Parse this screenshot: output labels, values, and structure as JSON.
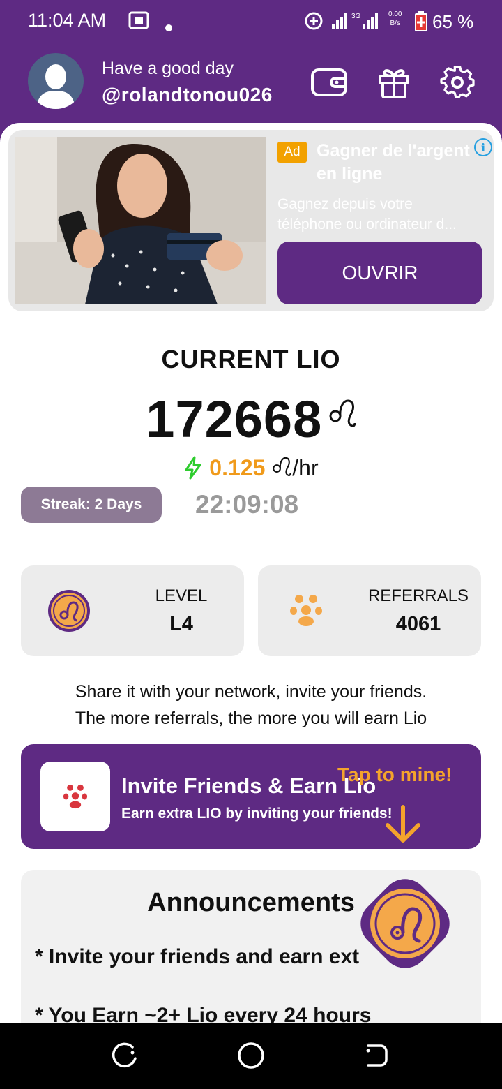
{
  "status_bar": {
    "time": "11:04 AM",
    "net_speed_value": "0.00",
    "net_speed_unit": "B/s",
    "network_type": "3G",
    "battery": "65 %"
  },
  "header": {
    "greeting": "Have a good day",
    "username": "@rolandtonou026",
    "icons": [
      "wallet-icon",
      "gift-icon",
      "settings-icon"
    ]
  },
  "ad": {
    "badge": "Ad",
    "title": "Gagner de l'argent en ligne",
    "description_line1": "Gagnez depuis votre",
    "description_line2": "téléphone ou ordinateur d...",
    "cta": "OUVRIR"
  },
  "mining": {
    "label": "CURRENT LIO",
    "balance": "172668",
    "currency_symbol": "♌",
    "rate_value": "0.125",
    "rate_unit": "/hr",
    "streak": "Streak: 2 Days",
    "timer": "22:09:08"
  },
  "stats": {
    "level_label": "LEVEL",
    "level_value": "L4",
    "referrals_label": "REFERRALS",
    "referrals_value": "4061"
  },
  "share": {
    "line1": "Share it with your network, invite your friends.",
    "line2": "The more referrals, the more you will earn Lio"
  },
  "invite": {
    "title": "Invite Friends & Earn Lio",
    "subtitle": "Earn extra LIO by inviting your friends!",
    "tap_hint": "Tap to mine!"
  },
  "announcements": {
    "title": "Announcements",
    "items": [
      "* Invite your friends and earn ext",
      "* You Earn ~2+ Lio every 24 hours"
    ]
  },
  "colors": {
    "brand_purple": "#5e2a83",
    "accent_orange": "#f09a1a",
    "streak_bg": "#8d7a95"
  }
}
